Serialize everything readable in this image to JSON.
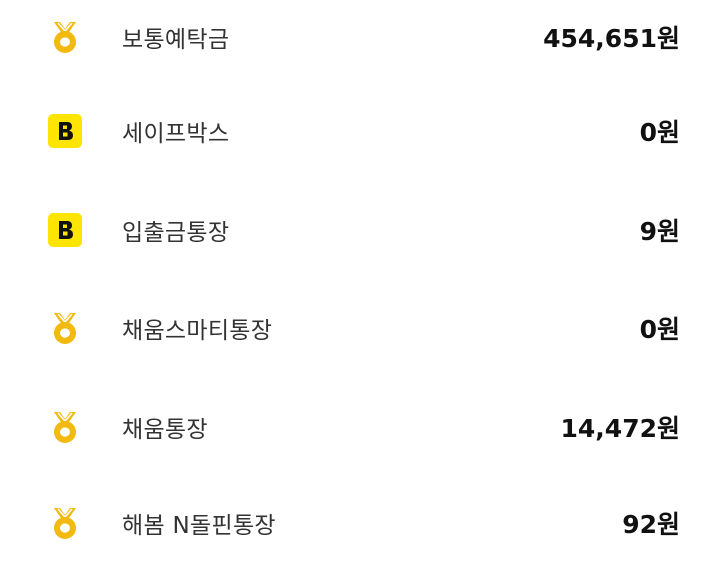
{
  "accounts": [
    {
      "icon": "kb-star-icon",
      "name": "보통예탁금",
      "amount": "454,651원"
    },
    {
      "icon": "kakaobank-icon",
      "name": "세이프박스",
      "amount": "0원"
    },
    {
      "icon": "kakaobank-icon",
      "name": "입출금통장",
      "amount": "9원"
    },
    {
      "icon": "kb-star-icon",
      "name": "채움스마티통장",
      "amount": "0원"
    },
    {
      "icon": "kb-star-icon",
      "name": "채움통장",
      "amount": "14,472원"
    },
    {
      "icon": "kb-star-icon",
      "name": "해봄 N돌핀통장",
      "amount": "92원"
    }
  ],
  "colors": {
    "kb_gold": "#F2B90F",
    "kakao_yellow": "#FEE500",
    "text_primary": "#111111",
    "text_secondary": "#333333"
  }
}
